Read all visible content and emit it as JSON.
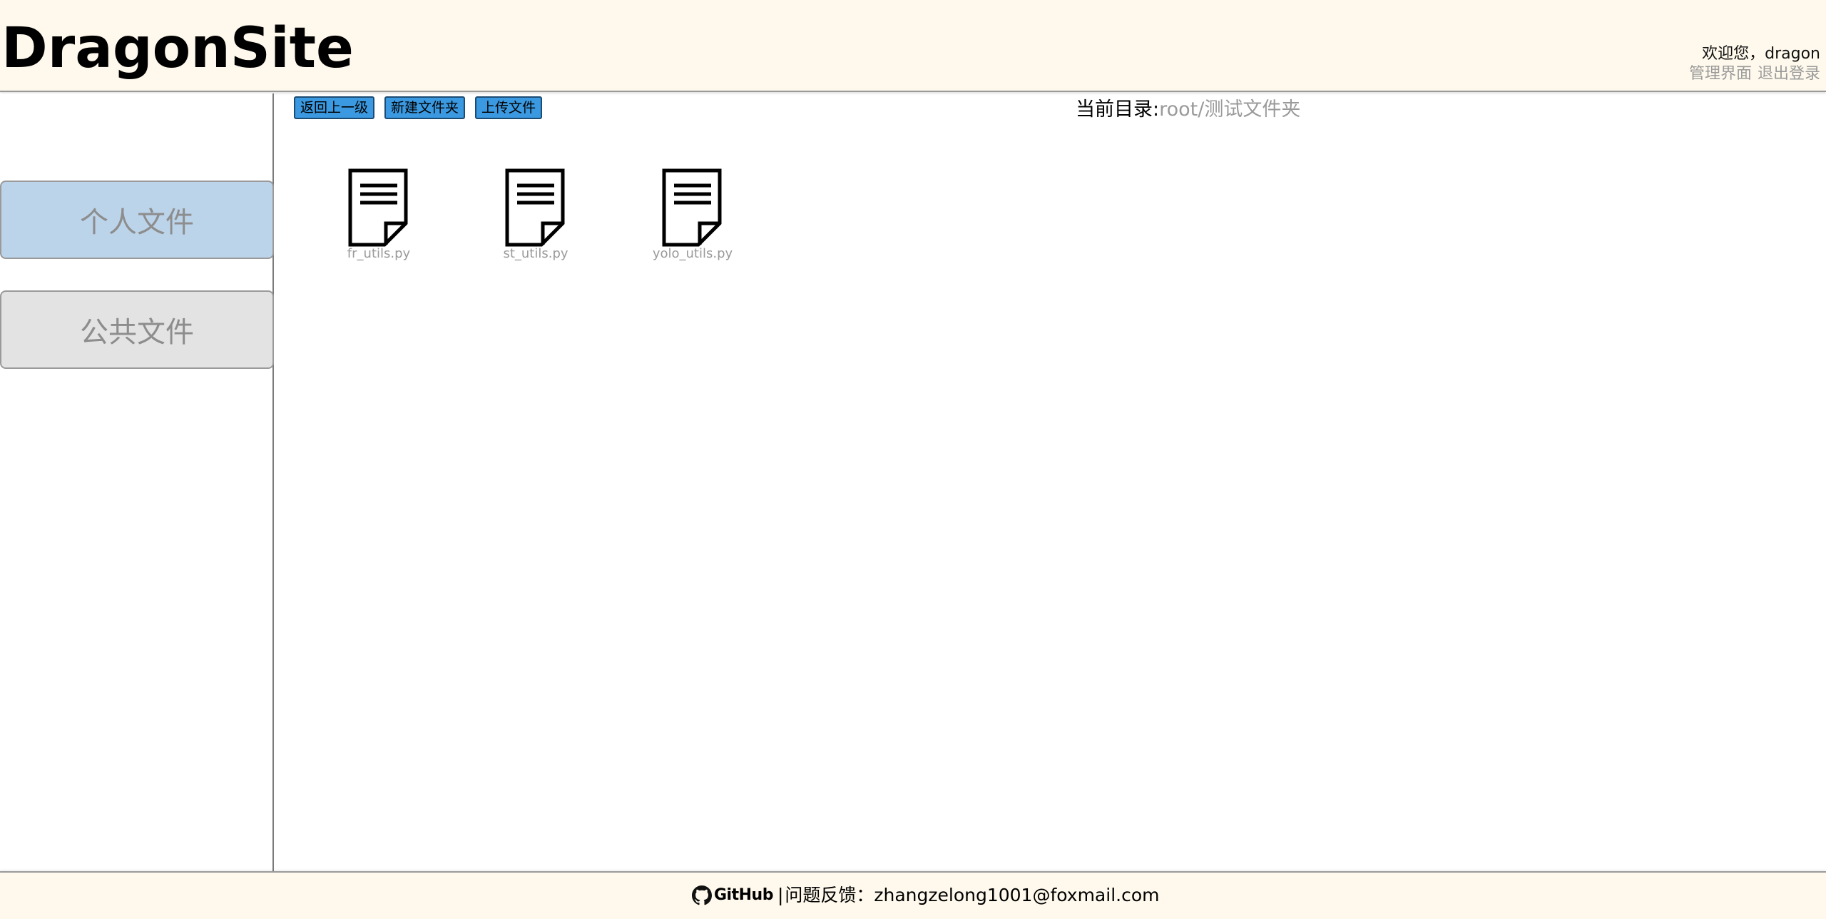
{
  "header": {
    "site_title": "DragonSite",
    "welcome": "欢迎您，dragon",
    "admin_link": "管理界面",
    "logout_link": "退出登录"
  },
  "sidebar": {
    "items": [
      {
        "label": "个人文件",
        "active": true
      },
      {
        "label": "公共文件",
        "active": false
      }
    ]
  },
  "toolbar": {
    "back_label": "返回上一级",
    "new_folder_label": "新建文件夹",
    "upload_label": "上传文件"
  },
  "current_dir": {
    "label": "当前目录:",
    "path": "root/测试文件夹"
  },
  "files": [
    {
      "name": "fr_utils.py",
      "icon": "document-icon"
    },
    {
      "name": "st_utils.py",
      "icon": "document-icon"
    },
    {
      "name": "yolo_utils.py",
      "icon": "document-icon"
    }
  ],
  "footer": {
    "github_label": "GitHub",
    "separator": "|",
    "feedback": "问题反馈：zhangzelong1001@foxmail.com"
  },
  "colors": {
    "header_bg": "#fef9ec",
    "active_tab": "#bcd4ea",
    "inactive_tab": "#e3e3e3",
    "button_bg": "#3a99e0",
    "muted_text": "#9a9a9a"
  }
}
